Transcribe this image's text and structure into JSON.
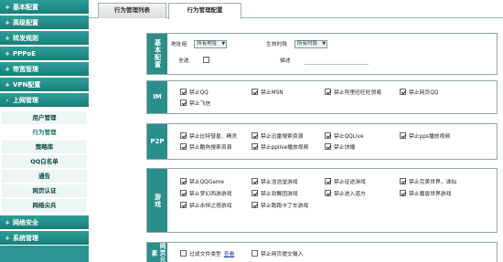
{
  "sidebar": {
    "items": [
      {
        "sign": "+",
        "label": "基本配置"
      },
      {
        "sign": "+",
        "label": "高级配置"
      },
      {
        "sign": "+",
        "label": "转发规则"
      },
      {
        "sign": "+",
        "label": "PPPoE"
      },
      {
        "sign": "+",
        "label": "带宽管理"
      },
      {
        "sign": "+",
        "label": "VPN配置"
      },
      {
        "sign": "-",
        "label": "上网管理"
      }
    ],
    "subitems": [
      "用户管理",
      "行为管理",
      "策略库",
      "QQ白名单",
      "通告",
      "网页认证",
      "网络尖兵"
    ],
    "bottom_items": [
      {
        "sign": "+",
        "label": "网络安全"
      },
      {
        "sign": "+",
        "label": "系统管理"
      }
    ]
  },
  "tabs": [
    "行为管理列表",
    "行为管理配置"
  ],
  "basic": {
    "title": "基本配置",
    "address_group_label": "地址组",
    "address_group_value": "所有地址",
    "time_label": "生效时段",
    "time_value": "所有时段",
    "select_all_label": "全选",
    "desc_label": "描述"
  },
  "im": {
    "title": "IM",
    "items": [
      "禁止QQ",
      "禁止MSN",
      "禁止阿里旺旺旺贸易",
      "禁止网页QQ",
      "禁止飞信"
    ]
  },
  "p2p": {
    "title": "P2P",
    "items": [
      "禁止比特彗星、精灵",
      "禁止迅雷搜索资源",
      "禁止QQLive",
      "禁止pps播放视频",
      "禁止酷狗搜索资源",
      "禁止pplive播放视频",
      "禁止快播"
    ]
  },
  "game": {
    "title": "游戏",
    "items": [
      "禁止QQGame",
      "禁止浩浩堂游戏",
      "禁止征途游戏",
      "禁止完美世界，诛仙",
      "禁止梦幻西游游戏",
      "禁止劲舞团游戏",
      "禁止进入道方",
      "禁止魔兽世界游戏",
      "禁止永恒之塔游戏",
      "禁止跑跑卡丁车游戏"
    ]
  },
  "web": {
    "title": "网页元素",
    "filter_label": "过滤文件类型",
    "filter_link": "查看",
    "submit_label": "禁止网页提交输入"
  }
}
